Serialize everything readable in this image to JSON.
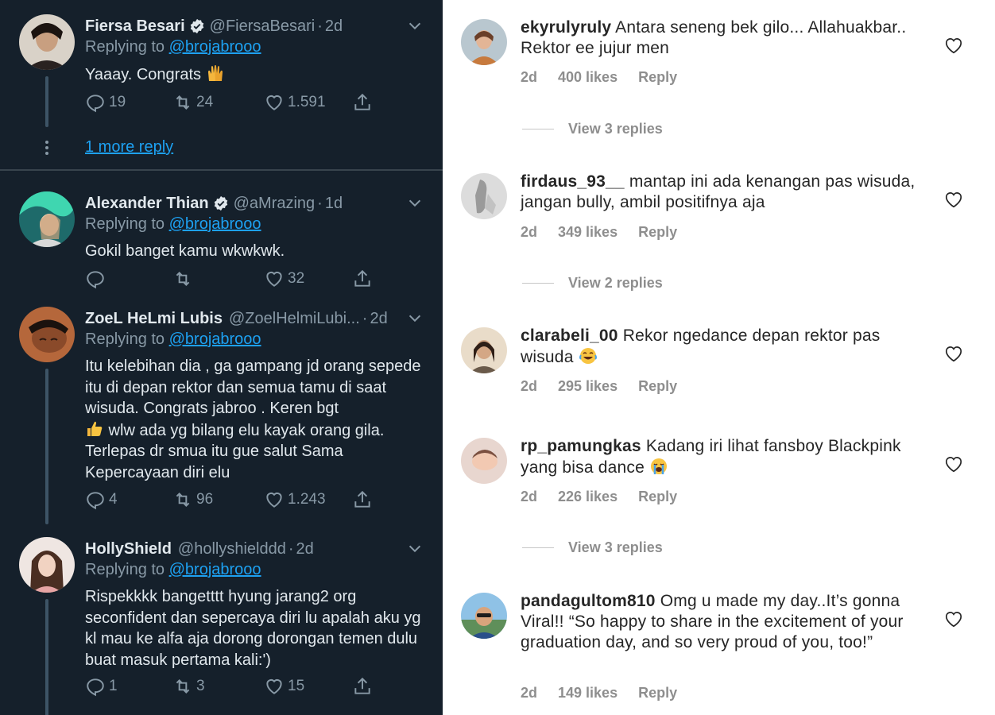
{
  "twitter": {
    "tweets": [
      {
        "name": "Fiersa Besari",
        "handle": "@FiersaBesari",
        "time": "2d",
        "replying_label": "Replying to",
        "replying_to": "@brojabrooo",
        "text": "Yaaay. Congrats",
        "replies": "19",
        "retweets": "24",
        "likes": "1.591"
      },
      {
        "name": "Alexander Thian",
        "handle": "@aMrazing",
        "time": "1d",
        "replying_label": "Replying to",
        "replying_to": "@brojabrooo",
        "text": "Gokil banget kamu wkwkwk.",
        "replies": "",
        "retweets": "",
        "likes": "32"
      },
      {
        "name": "ZoeL HeLmi Lubis",
        "handle": "@ZoelHelmiLubi...",
        "time": "2d",
        "replying_label": "Replying to",
        "replying_to": "@brojabrooo",
        "text_line1": "Itu kelebihan dia , ga gampang jd orang sepede itu di depan rektor dan semua tamu di saat wisuda.  Congrats jabroo . Keren bgt",
        "text_line2": " wlw ada yg bilang elu kayak orang gila. Terlepas dr smua itu gue salut Sama Kepercayaan diri elu",
        "replies": "4",
        "retweets": "96",
        "likes": "1.243"
      },
      {
        "name": "HollyShield",
        "handle": "@hollyshielddd",
        "time": "2d",
        "replying_label": "Replying to",
        "replying_to": "@brojabrooo",
        "text": "Rispekkkk bangetttt hyung jarang2 org seconfident dan sepercaya diri lu apalah aku yg kl mau ke alfa aja dorong dorongan temen dulu buat masuk pertama kali:')",
        "replies": "1",
        "retweets": "3",
        "likes": "15"
      }
    ],
    "more_reply": "1 more reply"
  },
  "instagram": {
    "comments": [
      {
        "user": "ekyrulyruly",
        "text": "Antara seneng bek gilo... Allahuakbar.. Rektor ee jujur men",
        "time": "2d",
        "likes": "400 likes",
        "reply": "Reply",
        "view_replies": "View 3 replies"
      },
      {
        "user": "firdaus_93__",
        "text": "mantap ini ada kenangan pas wisuda, jangan bully, ambil positifnya aja",
        "time": "2d",
        "likes": "349 likes",
        "reply": "Reply",
        "view_replies": "View 2 replies"
      },
      {
        "user": "clarabeli_00",
        "text": "Rekor ngedance depan rektor pas wisuda",
        "time": "2d",
        "likes": "295 likes",
        "reply": "Reply"
      },
      {
        "user": "rp_pamungkas",
        "text": "Kadang iri lihat fansboy Blackpink yang bisa dance",
        "time": "2d",
        "likes": "226 likes",
        "reply": "Reply",
        "view_replies": "View 3 replies"
      },
      {
        "user": "pandagultom810",
        "text": "Omg u made my day..It’s gonna Viral!! “So happy to share in the excitement of your graduation day, and so very proud of you, too!”",
        "time": "2d",
        "likes": "149 likes",
        "reply": "Reply"
      }
    ]
  },
  "colors": {
    "twitter_bg": "#15202b",
    "twitter_link": "#1da1f2",
    "twitter_muted": "#8899a6",
    "ig_text": "#262626",
    "ig_muted": "#8e8e8e"
  },
  "icons": [
    "reply-icon",
    "retweet-icon",
    "like-icon",
    "share-icon",
    "verified-icon",
    "chevron-down-icon",
    "heart-icon",
    "raising-hands-emoji",
    "thumbs-up-emoji",
    "joy-emoji",
    "sob-emoji"
  ]
}
